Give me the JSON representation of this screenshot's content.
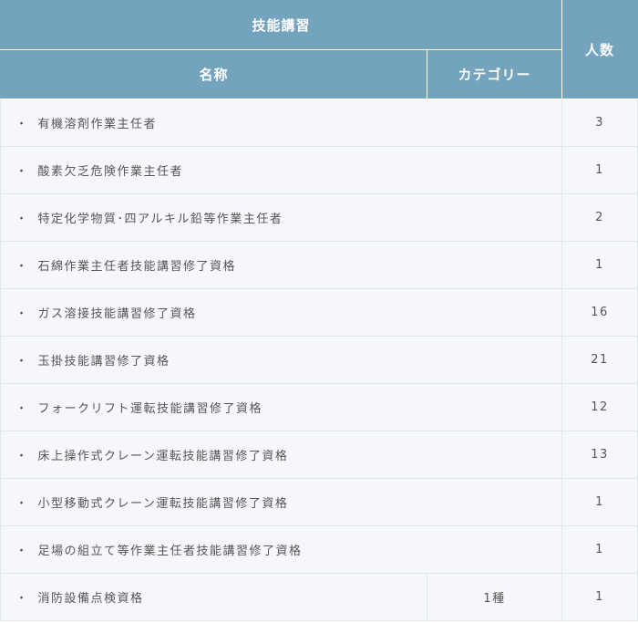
{
  "table": {
    "group_header": "技能講習",
    "count_header": "人数",
    "name_header": "名称",
    "category_header": "カテゴリー",
    "bullet": "・",
    "rows": [
      {
        "name": "有機溶剤作業主任者",
        "category": "",
        "count": "3"
      },
      {
        "name": "酸素欠乏危険作業主任者",
        "category": "",
        "count": "1"
      },
      {
        "name": "特定化学物質･四アルキル鉛等作業主任者",
        "category": "",
        "count": "2"
      },
      {
        "name": "石綿作業主任者技能講習修了資格",
        "category": "",
        "count": "1"
      },
      {
        "name": "ガス溶接技能講習修了資格",
        "category": "",
        "count": "16"
      },
      {
        "name": "玉掛技能講習修了資格",
        "category": "",
        "count": "21"
      },
      {
        "name": "フォークリフト運転技能講習修了資格",
        "category": "",
        "count": "12"
      },
      {
        "name": "床上操作式クレーン運転技能講習修了資格",
        "category": "",
        "count": "13"
      },
      {
        "name": "小型移動式クレーン運転技能講習修了資格",
        "category": "",
        "count": "1"
      },
      {
        "name": "足場の組立て等作業主任者技能講習修了資格",
        "category": "",
        "count": "1"
      },
      {
        "name": "消防設備点検資格",
        "category": "1種",
        "count": "1"
      }
    ]
  }
}
